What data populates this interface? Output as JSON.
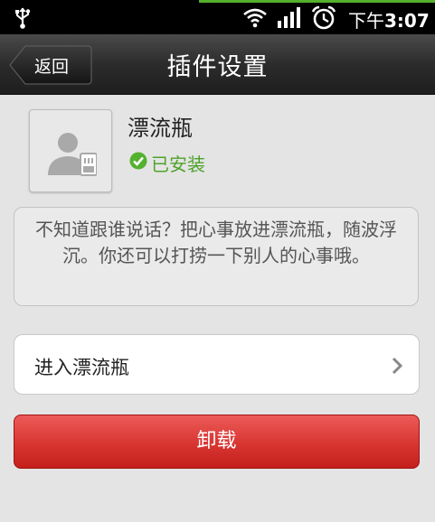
{
  "status_bar": {
    "ampm": "下午",
    "time": "3:07"
  },
  "header": {
    "back_label": "返回",
    "title": "插件设置"
  },
  "plugin": {
    "name": "漂流瓶",
    "status": "已安装",
    "description": "不知道跟谁说话？把心事放进漂流瓶，随波浮沉。你还可以打捞一下别人的心事哦。"
  },
  "actions": {
    "enter_label": "进入漂流瓶",
    "uninstall_label": "卸载"
  },
  "colors": {
    "installed": "#4ea329",
    "uninstall": "#d83531"
  }
}
